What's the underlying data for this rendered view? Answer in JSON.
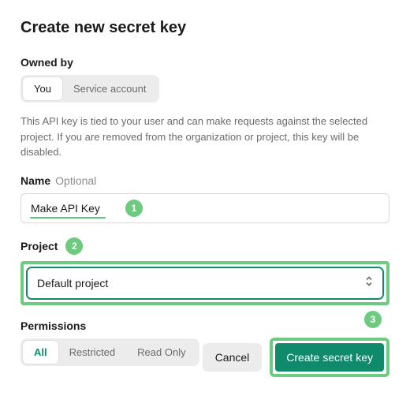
{
  "title": "Create new secret key",
  "owned_by": {
    "label": "Owned by",
    "options": [
      "You",
      "Service account"
    ],
    "active": "You"
  },
  "helper_text": "This API key is tied to your user and can make requests against the selected project. If you are removed from the organization or project, this key will be disabled.",
  "name_field": {
    "label": "Name",
    "optional_text": "Optional",
    "value": "Make API Key"
  },
  "project_field": {
    "label": "Project",
    "value": "Default project"
  },
  "permissions": {
    "label": "Permissions",
    "options": [
      "All",
      "Restricted",
      "Read Only"
    ],
    "active": "All"
  },
  "footer": {
    "cancel": "Cancel",
    "create": "Create secret key"
  },
  "annotations": {
    "b1": "1",
    "b2": "2",
    "b3": "3"
  }
}
